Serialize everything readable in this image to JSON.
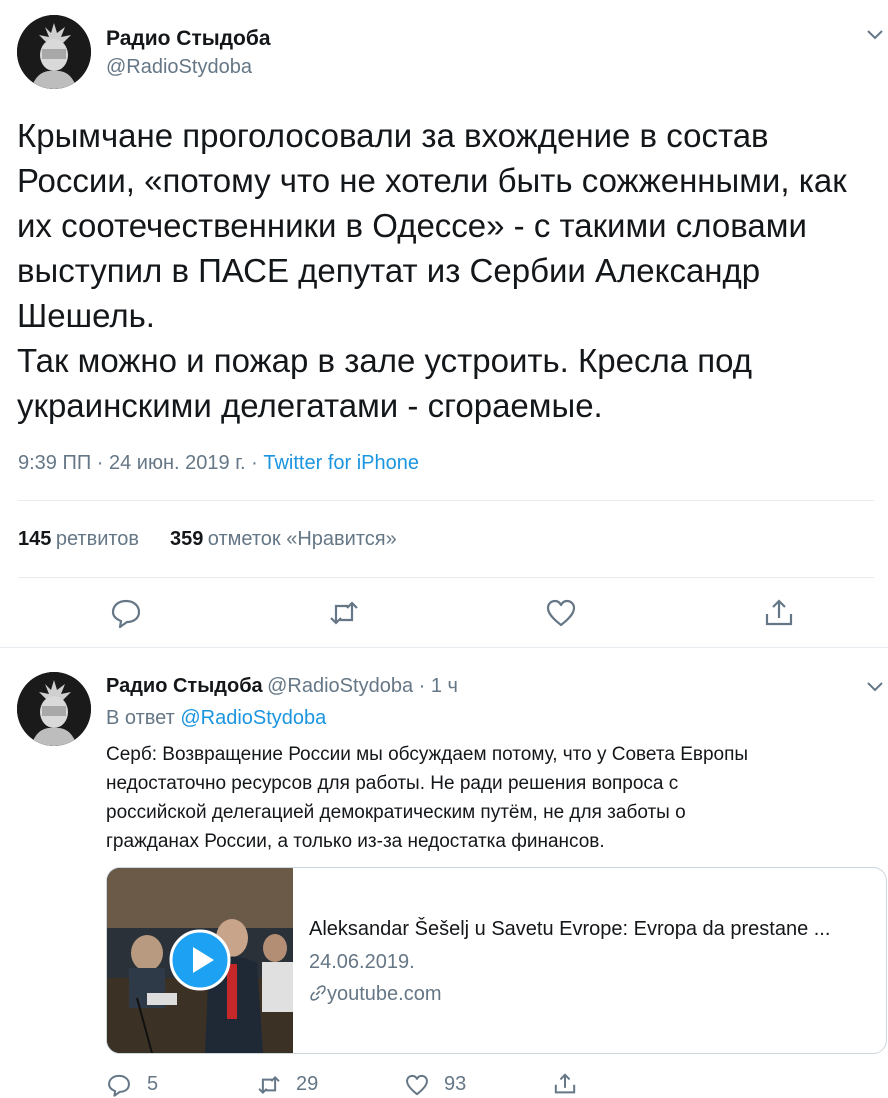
{
  "tweet": {
    "author_name": "Радио Стыдоба",
    "author_handle": "@RadioStydoba",
    "text_lines": [
      "Крымчане проголосовали за вхождение в состав",
      "России, «потому что не хотели быть сожженными, как",
      "их соотечественники в Одессе» - с такими словами",
      "выступил в ПАСЕ депутат из Сербии Александр",
      "Шешель.",
      "Так можно и пожар в зале устроить. Кресла под",
      "украинскими делегатами - сгораемые."
    ],
    "timestamp": "9:39 ПП · 24 июн. 2019 г. · ",
    "source": "Twitter for iPhone",
    "retweets_count": "145",
    "retweets_label": "ретвитов",
    "likes_count": "359",
    "likes_label": "отметок «Нравится»",
    "icons": [
      "reply-icon",
      "retweet-icon",
      "like-icon",
      "share-icon",
      "chevron-down-icon"
    ]
  },
  "reply": {
    "author_name": "Радио Стыдоба",
    "author_handle": "@RadioStydoba",
    "time": " · 1 ч",
    "in_reply_prefix": "В ответ ",
    "in_reply_handle": "@RadioStydoba",
    "text_lines": [
      "Серб: Возвращение России мы обсуждаем потому, что у Совета Европы",
      "недостаточно ресурсов для работы. Не ради решения вопроса с",
      "российской делегацией демократическим путём, не для заботы о",
      "гражданах России, а только из-за недостатка финансов."
    ],
    "card": {
      "title": "Aleksandar Šešelj u Savetu Evrope: Evropa da prestane ...",
      "date": "24.06.2019.",
      "domain": "youtube.com"
    },
    "reply_count": "5",
    "retweet_count": "29",
    "like_count": "93",
    "colors": {
      "link": "#1b95e0",
      "play_button": "#1da1f2"
    }
  }
}
